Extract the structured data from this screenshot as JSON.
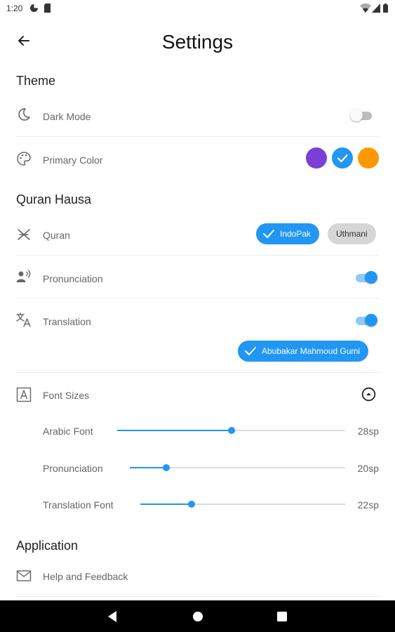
{
  "status_bar": {
    "time": "1:20"
  },
  "header": {
    "title": "Settings"
  },
  "sections": {
    "theme": "Theme",
    "quran_hausa": "Quran Hausa",
    "application": "Application"
  },
  "theme": {
    "dark_mode": {
      "label": "Dark Mode",
      "enabled": false
    },
    "primary_color": {
      "label": "Primary Color",
      "colors": [
        "#7b3fd6",
        "#2196f3",
        "#ff9800"
      ],
      "selected_index": 1
    }
  },
  "quran": {
    "label": "Quran",
    "options": [
      "IndoPak",
      "Uthmani"
    ],
    "selected": "IndoPak"
  },
  "pronunciation": {
    "label": "Pronunciation",
    "enabled": true
  },
  "translation": {
    "label": "Translation",
    "enabled": true,
    "translator": "Abubakar Mahmoud Gumi"
  },
  "font_sizes": {
    "label": "Font Sizes",
    "items": [
      {
        "label": "Arabic Font",
        "value": "28sp",
        "fraction": 0.5
      },
      {
        "label": "Pronunciation",
        "value": "20sp",
        "fraction": 0.17
      },
      {
        "label": "Translation Font",
        "value": "22sp",
        "fraction": 0.25
      }
    ]
  },
  "application": {
    "help": {
      "label": "Help and Feedback"
    }
  },
  "colors": {
    "accent": "#2196f3",
    "accent_light": "#90caf9"
  },
  "icons": {
    "back": "arrow-back-icon",
    "dark_mode": "moon-icon",
    "primary_color": "palette-icon",
    "quran": "book-icon",
    "pronunciation": "speaking-person-icon",
    "translation": "translate-icon",
    "font_sizes": "font-icon",
    "help": "mail-icon"
  }
}
